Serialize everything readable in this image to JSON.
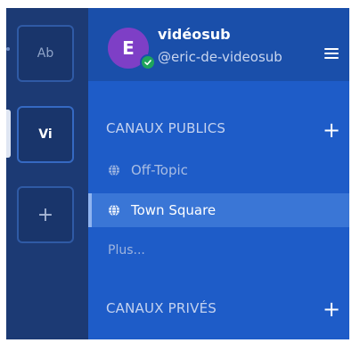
{
  "teams": [
    {
      "initials": "Ab",
      "active": false
    },
    {
      "initials": "Vi",
      "active": true
    }
  ],
  "add_team_symbol": "+",
  "header": {
    "avatar_initial": "E",
    "team_name": "vidéosub",
    "username": "@eric-de-videosub",
    "menu_icon": "hamburger-menu-icon"
  },
  "public_channels": {
    "title": "CANAUX PUBLICS",
    "add_symbol": "+",
    "items": [
      {
        "name": "Off-Topic",
        "icon": "globe-icon",
        "active": false
      },
      {
        "name": "Town Square",
        "icon": "globe-icon",
        "active": true
      }
    ],
    "more_label": "Plus..."
  },
  "private_channels": {
    "title": "CANAUX PRIVÉS",
    "add_symbol": "+"
  },
  "colors": {
    "team_sidebar_bg": "#1c3a74",
    "channel_sidebar_bg": "#1e5cc8",
    "active_channel_bg": "#3a76d6",
    "avatar_bg": "#7e3fc6",
    "status_online": "#1fa45c"
  }
}
